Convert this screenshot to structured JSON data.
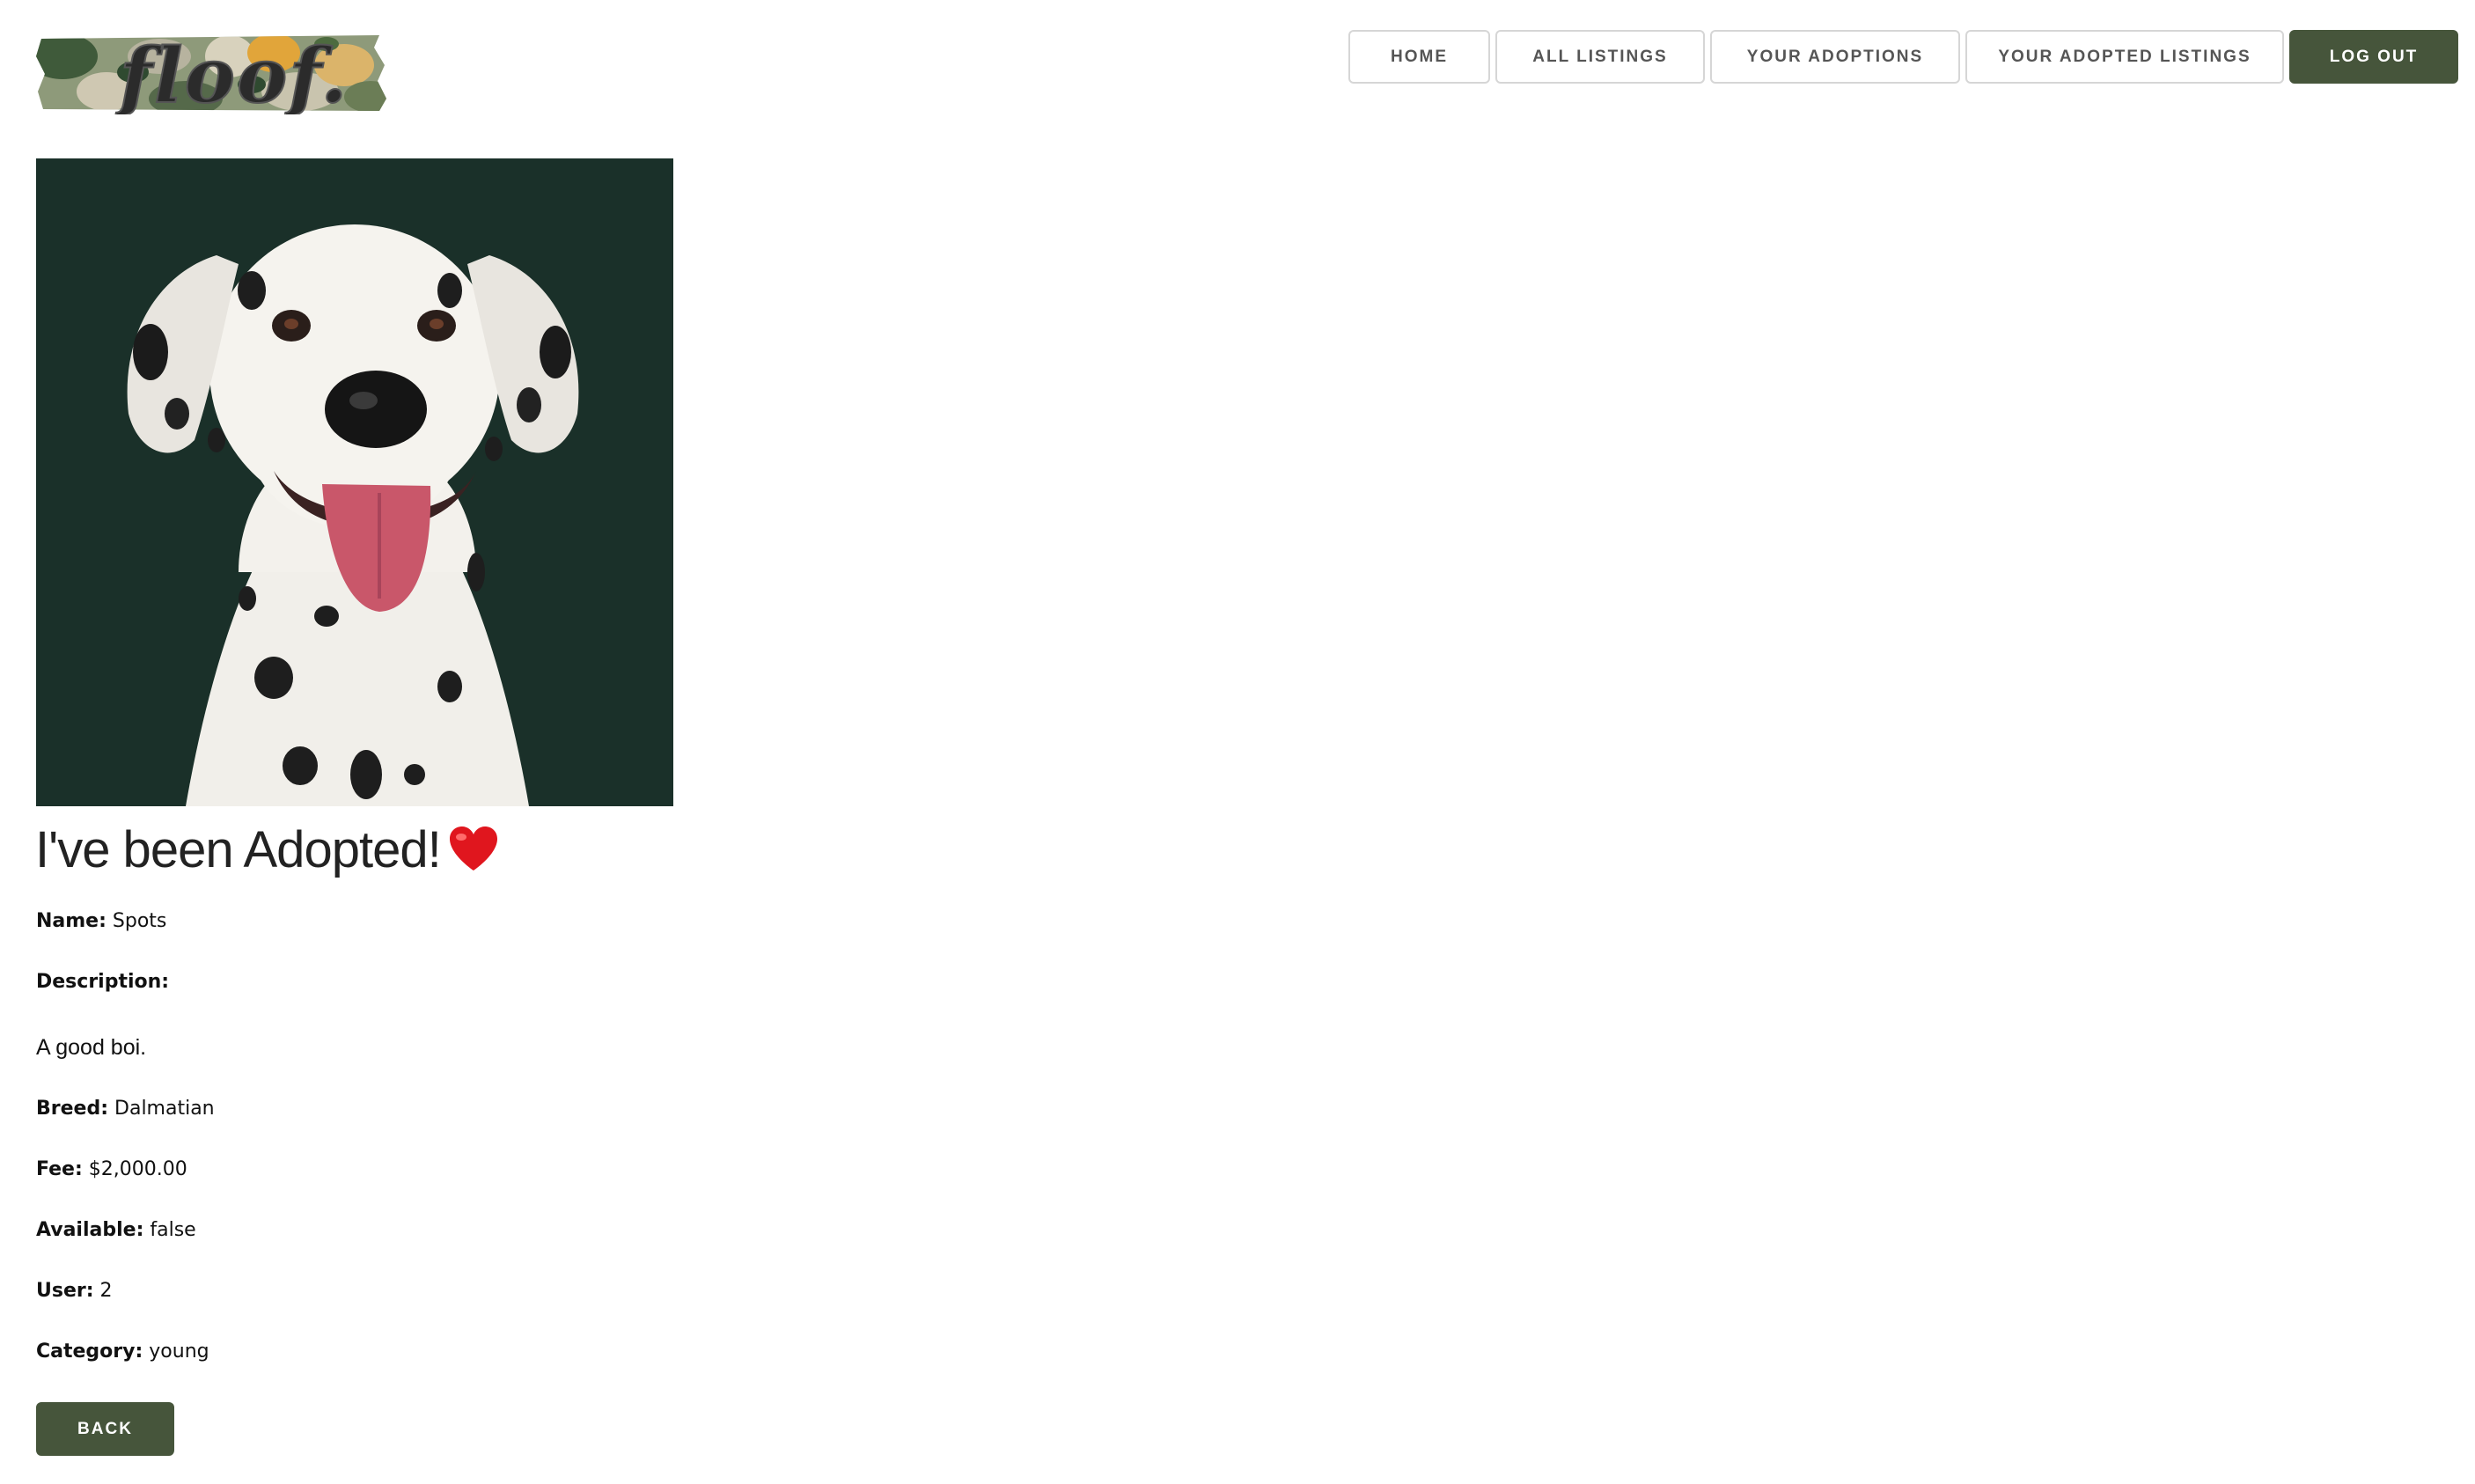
{
  "header": {
    "logo_text": "floof.",
    "nav": [
      {
        "label": "HOME"
      },
      {
        "label": "ALL LISTINGS"
      },
      {
        "label": "YOUR ADOPTIONS"
      },
      {
        "label": "YOUR ADOPTED LISTINGS"
      },
      {
        "label": "LOG OUT"
      }
    ]
  },
  "listing": {
    "photo_icon": "dalmatian-photo",
    "heading": "I've been Adopted!",
    "heading_icon": "heart-icon",
    "name_label": "Name:",
    "name": "Spots",
    "description_label": "Description:",
    "description": "A good boi.",
    "breed_label": "Breed:",
    "breed": "Dalmatian",
    "fee_label": "Fee:",
    "fee": "$2,000.00",
    "available_label": "Available:",
    "available": "false",
    "user_label": "User:",
    "user": "2",
    "category_label": "Category:",
    "category": "young",
    "back_label": "BACK"
  },
  "colors": {
    "accent": "#46553b",
    "photo_background": "#1a3029",
    "heart": "#e0161e"
  }
}
